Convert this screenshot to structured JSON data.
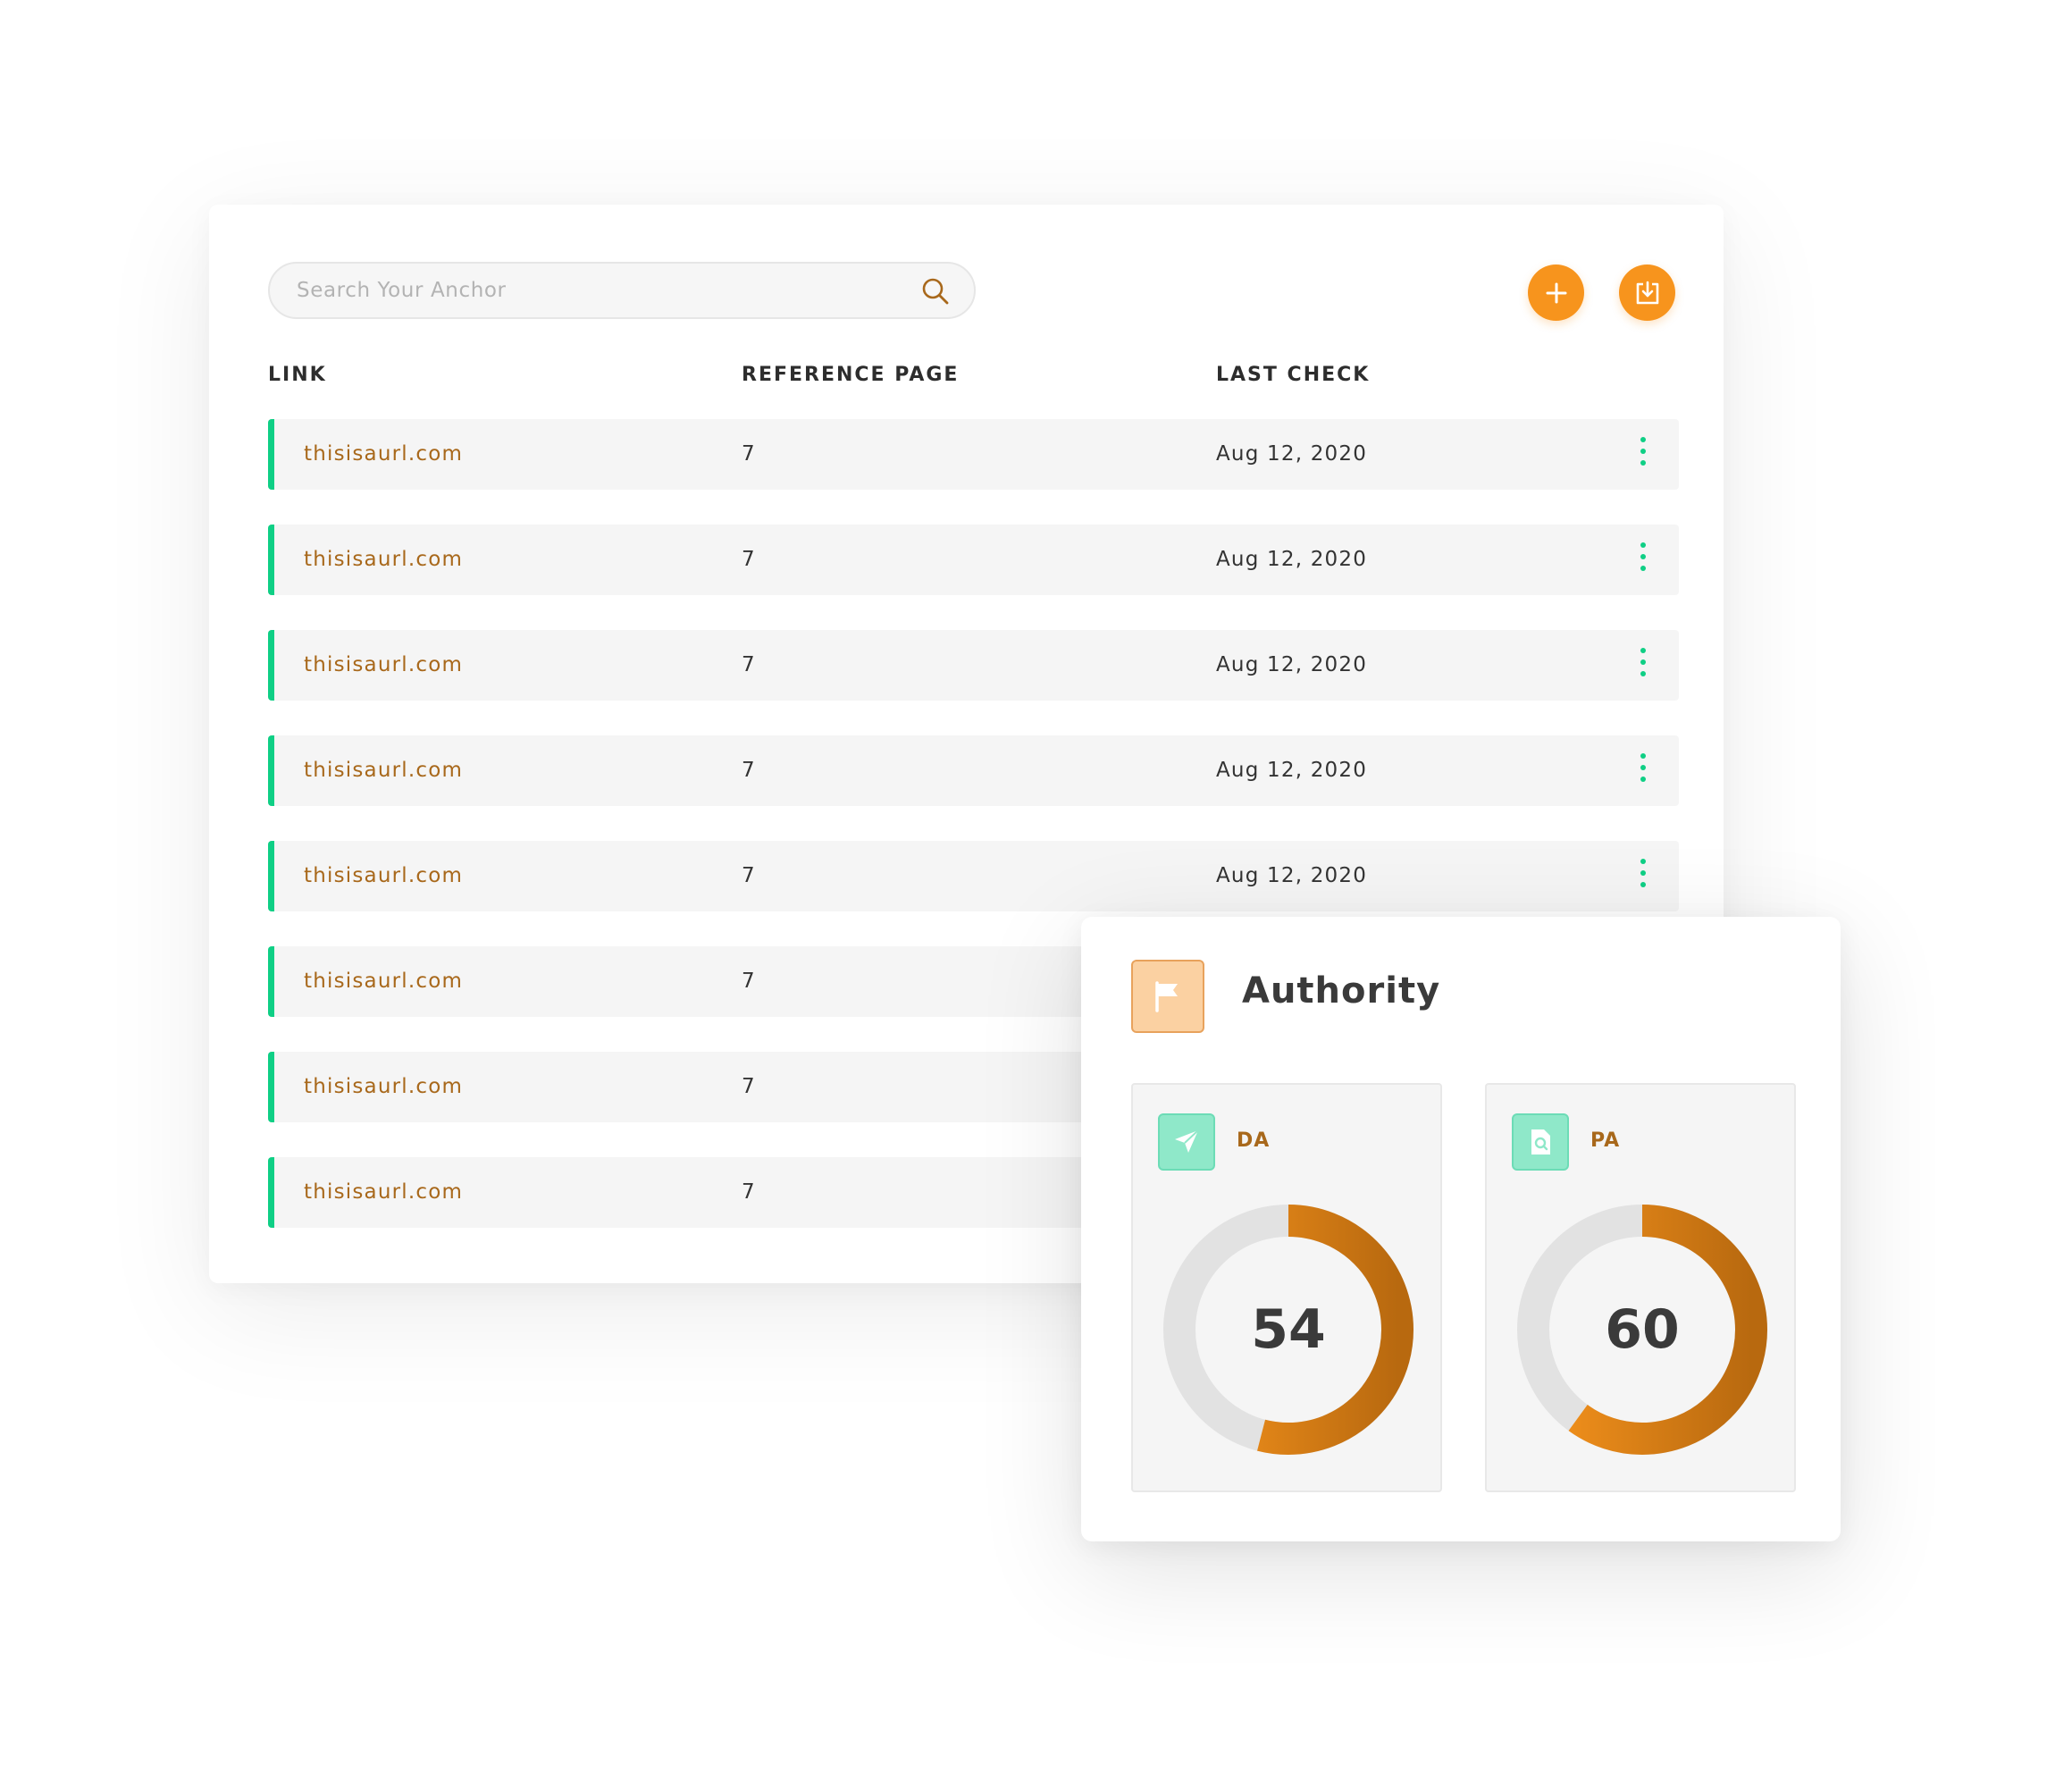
{
  "search": {
    "placeholder": "Search Your Anchor"
  },
  "toolbar": {
    "add_icon": "plus-icon",
    "download_icon": "download-icon"
  },
  "table": {
    "headers": {
      "link": "LINK",
      "reference_page": "REFERENCE PAGE",
      "last_check": "LAST CHECK"
    },
    "rows": [
      {
        "link": "thisisaurl.com",
        "ref": "7",
        "date": "Aug 12, 2020"
      },
      {
        "link": "thisisaurl.com",
        "ref": "7",
        "date": "Aug 12, 2020"
      },
      {
        "link": "thisisaurl.com",
        "ref": "7",
        "date": "Aug 12, 2020"
      },
      {
        "link": "thisisaurl.com",
        "ref": "7",
        "date": "Aug 12, 2020"
      },
      {
        "link": "thisisaurl.com",
        "ref": "7",
        "date": "Aug 12, 2020"
      },
      {
        "link": "thisisaurl.com",
        "ref": "7",
        "date": ""
      },
      {
        "link": "thisisaurl.com",
        "ref": "7",
        "date": ""
      },
      {
        "link": "thisisaurl.com",
        "ref": "7",
        "date": ""
      }
    ]
  },
  "authority": {
    "title": "Authority",
    "icon": "flag-icon",
    "metrics": [
      {
        "label": "DA",
        "value": "54",
        "progress": 0.54,
        "icon": "send-icon"
      },
      {
        "label": "PA",
        "value": "60",
        "progress": 0.6,
        "icon": "file-search-icon"
      }
    ]
  },
  "colors": {
    "accent": "#f7941d",
    "accent_dark": "#b8690f",
    "green": "#0fcf85",
    "link_text": "#a8681b",
    "track": "#e2e2e2"
  }
}
